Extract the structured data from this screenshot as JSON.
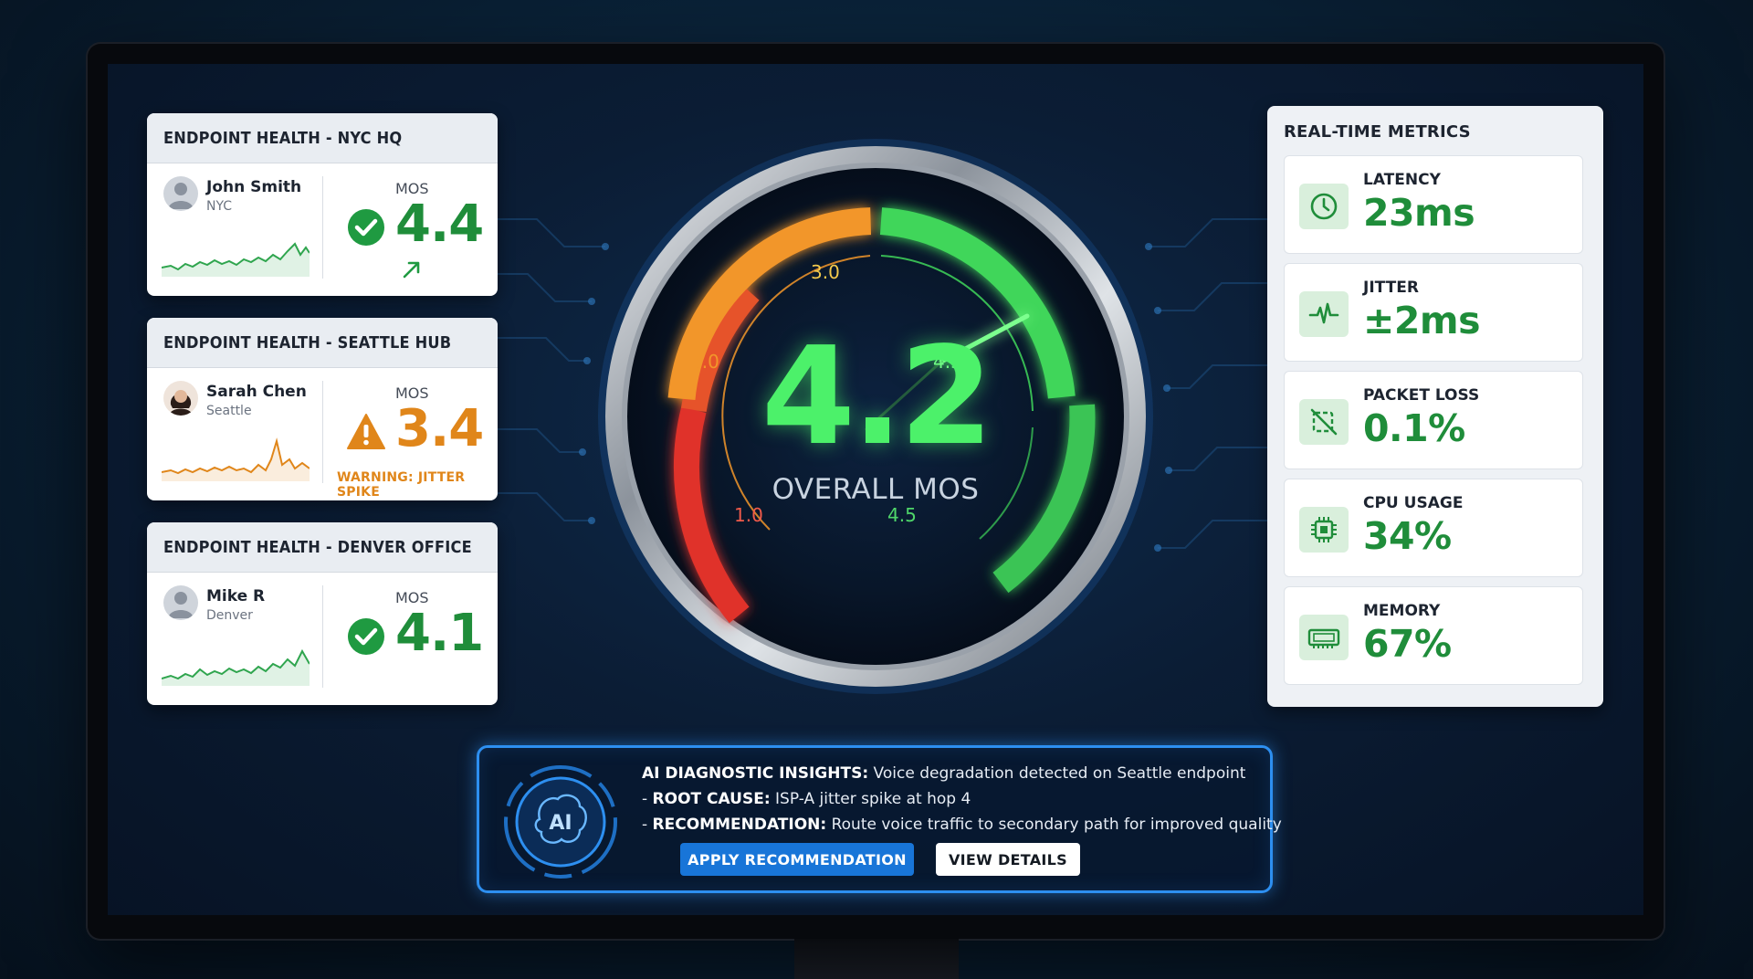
{
  "endpoints": [
    {
      "title": "ENDPOINT HEALTH - NYC HQ",
      "name": "John Smith",
      "location": "NYC",
      "mos_label": "MOS",
      "mos": "4.4",
      "status": "ok",
      "trend": "up",
      "note": "",
      "color": "#1f8d3a"
    },
    {
      "title": "ENDPOINT HEALTH - SEATTLE HUB",
      "name": "Sarah Chen",
      "location": "Seattle",
      "mos_label": "MOS",
      "mos": "3.4",
      "status": "warning",
      "trend": "",
      "note": "WARNING: JITTER SPIKE",
      "color": "#e0861a"
    },
    {
      "title": "ENDPOINT HEALTH - DENVER OFFICE",
      "name": "Mike R",
      "location": "Denver",
      "mos_label": "MOS",
      "mos": "4.1",
      "status": "ok",
      "trend": "",
      "note": "",
      "color": "#1f8d3a"
    }
  ],
  "gauge": {
    "value": "4.2",
    "label": "OVERALL MOS",
    "scale": {
      "min": 1.0,
      "max": 4.5
    },
    "ticks": [
      "3.0",
      "3.0",
      "4.5",
      "1.0",
      "4.5"
    ],
    "colors": {
      "low": "#e23a2a",
      "mid": "#f2962a",
      "high": "#3fd65a"
    }
  },
  "metrics": {
    "title": "REAL-TIME METRICS",
    "items": [
      {
        "label": "LATENCY",
        "value": "23ms",
        "icon": "clock-icon"
      },
      {
        "label": "JITTER",
        "value": "±2ms",
        "icon": "pulse-icon"
      },
      {
        "label": "PACKET LOSS",
        "value": "0.1%",
        "icon": "packet-loss-icon"
      },
      {
        "label": "CPU USAGE",
        "value": "34%",
        "icon": "cpu-icon"
      },
      {
        "label": "MEMORY",
        "value": "67%",
        "icon": "ram-icon"
      }
    ]
  },
  "ai": {
    "badge": "AI",
    "insight_label": "AI DIAGNOSTIC INSIGHTS:",
    "insight_text": "Voice degradation detected on Seattle endpoint",
    "root_prefix": "- ",
    "root_label": "ROOT CAUSE:",
    "root_text": "ISP-A jitter spike at hop 4",
    "rec_prefix": "- ",
    "rec_label": "RECOMMENDATION:",
    "rec_text": "Route voice traffic to secondary path for improved quality",
    "apply_button": "APPLY RECOMMENDATION",
    "details_button": "VIEW DETAILS"
  }
}
